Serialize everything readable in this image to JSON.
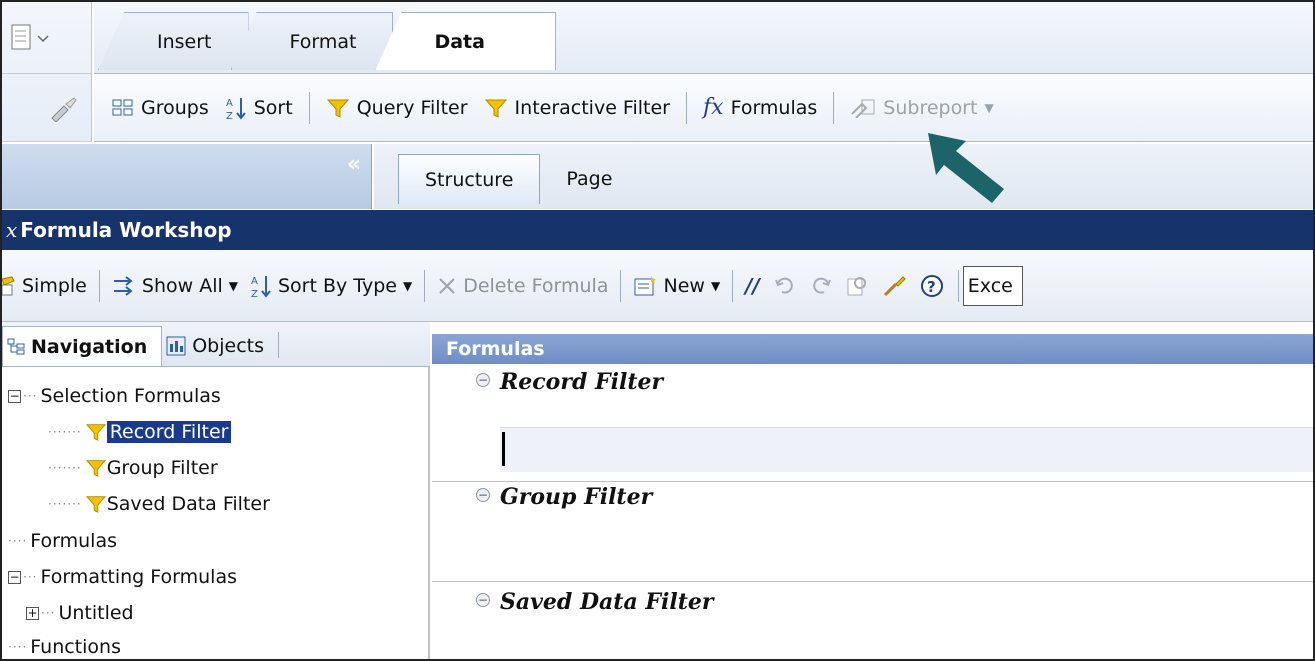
{
  "ribbon": {
    "tabs": [
      {
        "label": "Insert",
        "active": false
      },
      {
        "label": "Format",
        "active": false
      },
      {
        "label": "Data",
        "active": true
      }
    ]
  },
  "toolbar": {
    "groups": "Groups",
    "sort": "Sort",
    "query_filter": "Query Filter",
    "interactive_filter": "Interactive Filter",
    "formulas_icon_text": "fx",
    "formulas": "Formulas",
    "subreport": "Subreport"
  },
  "panel": {
    "collapse_glyph": "«"
  },
  "structure_tabs": [
    {
      "label": "Structure",
      "active": true
    },
    {
      "label": "Page",
      "active": false
    }
  ],
  "workshop": {
    "title": "Formula Workshop",
    "title_prefix": "x",
    "toolbar": {
      "simple": "Simple",
      "show_all": "Show All",
      "sort_by_type": "Sort By Type",
      "delete_formula": "Delete Formula",
      "new": "New",
      "comment": "//",
      "exception_box": "Exce"
    }
  },
  "navigation": {
    "tabs": [
      {
        "label": "Navigation",
        "active": true
      },
      {
        "label": "Objects",
        "active": false
      }
    ],
    "tree": {
      "selection_formulas": "Selection Formulas",
      "record_filter": "Record Filter",
      "group_filter": "Group Filter",
      "saved_data_filter": "Saved Data Filter",
      "formulas": "Formulas",
      "formatting_formulas": "Formatting Formulas",
      "untitled": "Untitled",
      "functions": "Functions"
    }
  },
  "formulas_pane": {
    "header": "Formulas",
    "sections": [
      {
        "title": "Record Filter"
      },
      {
        "title": "Group Filter"
      },
      {
        "title": "Saved Data Filter"
      }
    ]
  },
  "colors": {
    "title_bar": "#17336b",
    "selected": "#1a3a8e",
    "filter_icon": "#f2c200",
    "arrow": "#1d6468"
  }
}
